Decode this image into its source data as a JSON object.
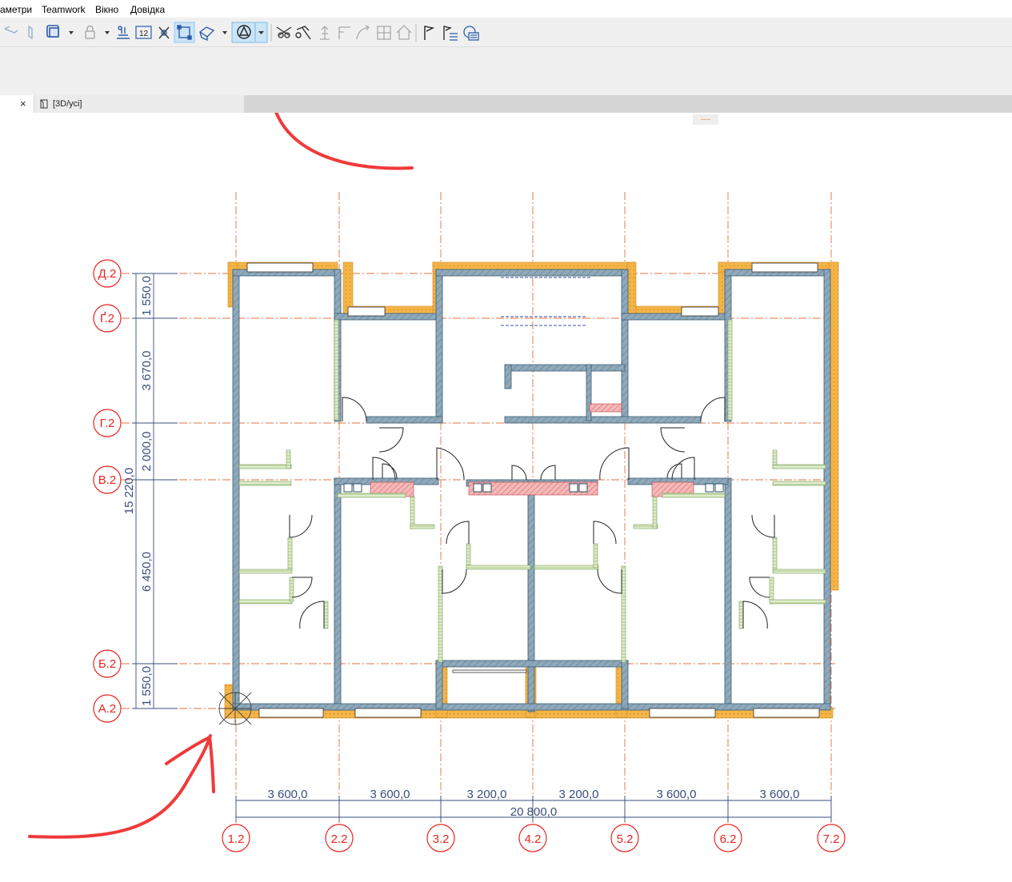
{
  "menu": {
    "items": [
      "аметри",
      "Teamwork",
      "Вікно",
      "Довідка"
    ]
  },
  "toolbar": {
    "icons": [
      "wall-tool",
      "column-tool",
      "view-layer",
      "dropdown",
      "lock",
      "dropdown",
      "adjust-elevation",
      "numbering-12",
      "trim",
      "frame-select",
      "3d-cube",
      "dropdown",
      "triangle-circle-active",
      "dropdown",
      "scissors",
      "hammer",
      "arrow-up",
      "corner",
      "arc",
      "grid-edit",
      "house",
      "flag",
      "flag-list",
      "magnifier-layers"
    ]
  },
  "tabs": {
    "close_glyph": "×",
    "view_tab_label": "[3D/усі]",
    "splitter_glyph": "----"
  },
  "plan": {
    "row_axes": [
      "Д.2",
      "Ґ.2",
      "Г.2",
      "В.2",
      "Б.2",
      "А.2"
    ],
    "col_axes": [
      "1.2",
      "2.2",
      "3.2",
      "4.2",
      "5.2",
      "6.2",
      "7.2"
    ],
    "row_dims": [
      "1 550,0",
      "3 670,0",
      "2 000,0",
      "6 450,0",
      "1 550,0"
    ],
    "row_total": "15 220,0",
    "col_dims": [
      "3 600,0",
      "3 600,0",
      "3 200,0",
      "3 200,0",
      "3 600,0",
      "3 600,0"
    ],
    "col_total": "20 800,0"
  },
  "colors": {
    "axis_red": "#e8241e",
    "grid_line": "#e07040",
    "dimension_blue": "#3a4e7c",
    "wall_blue": "#7f9bb0",
    "insulation_orange": "#f2b245",
    "partition_green": "#b9d29a",
    "annotation_red": "#f03a3a",
    "active_tool": "#cce4f7"
  }
}
